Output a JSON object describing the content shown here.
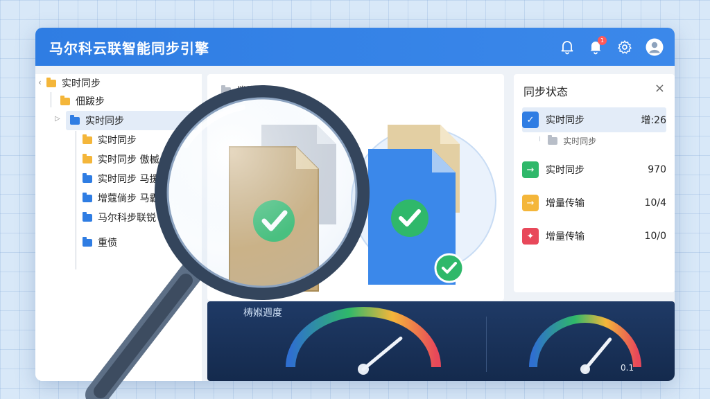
{
  "app": {
    "title": "马尔科云联智能同步引擎"
  },
  "header": {
    "notification_count": "1",
    "icons": [
      "bell-icon",
      "bell-icon",
      "gear-icon",
      "user-avatar-icon"
    ]
  },
  "tree": {
    "items": [
      {
        "label": "实时同步",
        "color": "yellow"
      },
      {
        "label": "佃跋步",
        "color": "yellow"
      },
      {
        "label": "实时同步",
        "color": "blue"
      },
      {
        "label": "实时同步",
        "color": "yellow"
      },
      {
        "label": "实时同步 傲楲",
        "color": "yellow"
      },
      {
        "label": "实时同步 马援",
        "color": "blue"
      },
      {
        "label": "增蔻倘步 马霸乐",
        "color": "blue"
      },
      {
        "label": "马尔科步联锐",
        "color": "blue"
      },
      {
        "label": "重偾",
        "color": "blue"
      }
    ]
  },
  "center": {
    "header_label": "偿懂",
    "gauge_label": "梼娰週度"
  },
  "status": {
    "title": "同步状态",
    "close": "×",
    "rows": [
      {
        "label": "实时同步",
        "value": "增:26",
        "color": "#2f7de3",
        "icon": "check-icon"
      },
      {
        "label": "实时同步",
        "value": "",
        "color": "#b8bec8",
        "icon": "folder-icon"
      },
      {
        "label": "实时同步",
        "value": "970",
        "color": "#2fb86a",
        "icon": "arrow-icon"
      },
      {
        "label": "增量传输",
        "value": "10/4",
        "color": "#f4b63a",
        "icon": "arrow-icon"
      },
      {
        "label": "增量传输",
        "value": "10/0",
        "color": "#e8485a",
        "icon": "star-icon"
      }
    ]
  },
  "gauges": {
    "right_value": "0.1",
    "levels": [
      0.78,
      0.72
    ]
  },
  "colors": {
    "accent": "#2f7de3",
    "success": "#2fb86a",
    "warning": "#f4b63a",
    "danger": "#e8485a"
  }
}
